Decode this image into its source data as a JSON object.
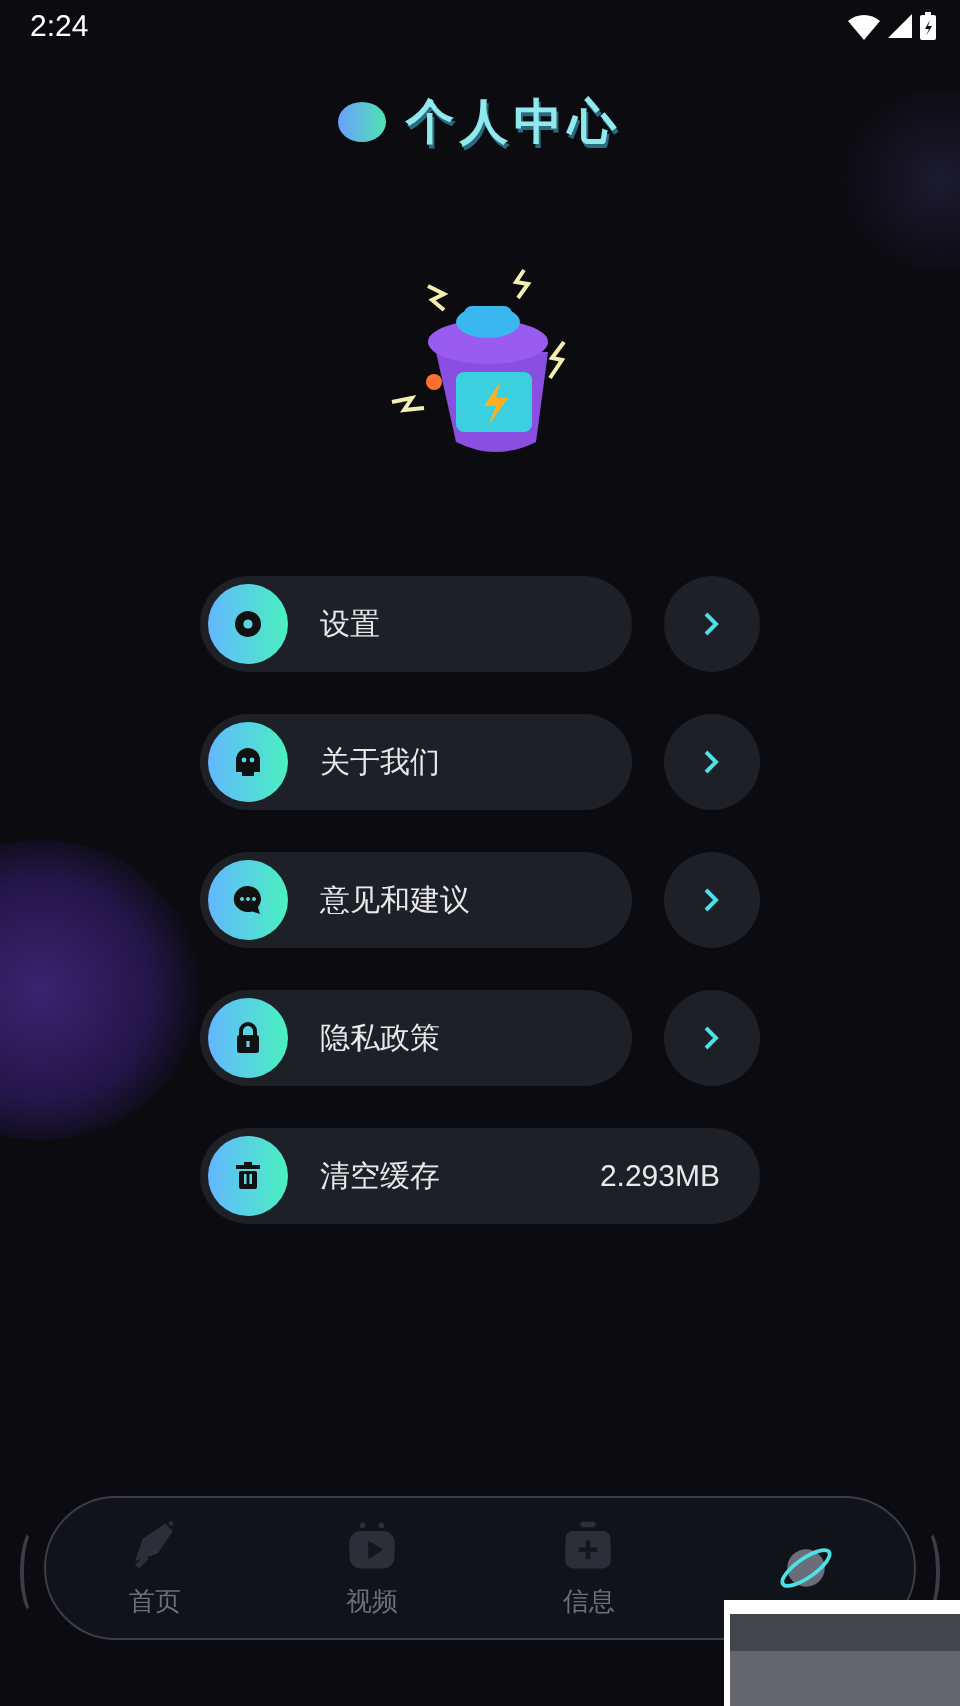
{
  "status_bar": {
    "time": "2:24"
  },
  "header": {
    "title": "个人中心"
  },
  "menu": [
    {
      "kind": "link",
      "label": "设置"
    },
    {
      "kind": "link",
      "label": "关于我们"
    },
    {
      "kind": "link",
      "label": "意见和建议"
    },
    {
      "kind": "link",
      "label": "隐私政策"
    },
    {
      "kind": "value",
      "label": "清空缓存",
      "value": "2.293MB"
    }
  ],
  "tabs": [
    {
      "label": "首页",
      "selected": false
    },
    {
      "label": "视频",
      "selected": false
    },
    {
      "label": "信息",
      "selected": false
    },
    {
      "selected": true
    }
  ]
}
